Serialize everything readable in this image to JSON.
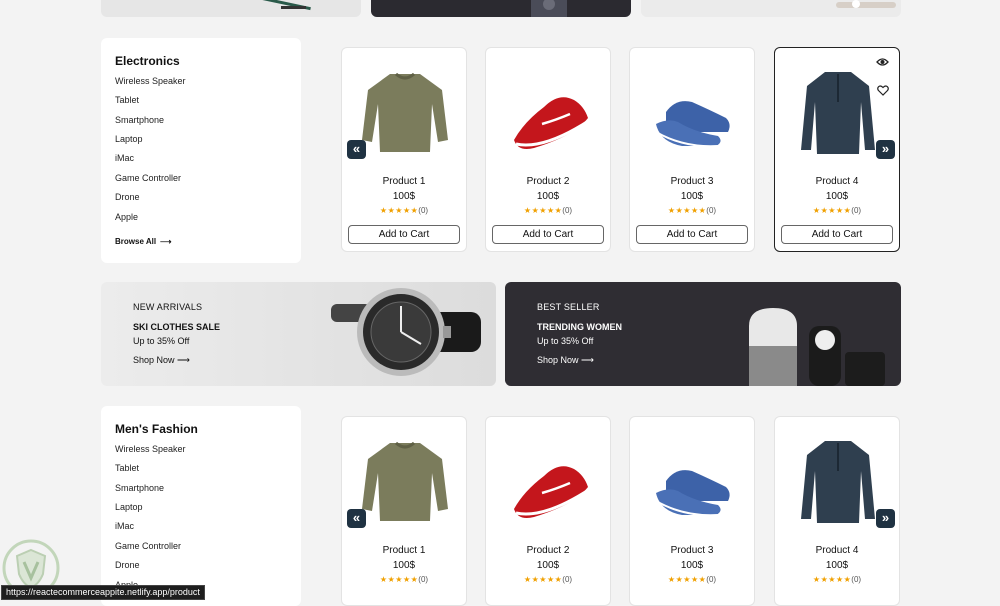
{
  "sections": [
    {
      "title": "Electronics",
      "categories": [
        "Wireless Speaker",
        "Tablet",
        "Smartphone",
        "Laptop",
        "iMac",
        "Game Controller",
        "Drone",
        "Apple"
      ],
      "browse_all": "Browse All",
      "products": [
        {
          "name": "Product 1",
          "price": "100$",
          "stars": "★★★★★",
          "count": "(0)",
          "button": "Add to Cart"
        },
        {
          "name": "Product 2",
          "price": "100$",
          "stars": "★★★★★",
          "count": "(0)",
          "button": "Add to Cart"
        },
        {
          "name": "Product 3",
          "price": "100$",
          "stars": "★★★★★",
          "count": "(0)",
          "button": "Add to Cart"
        },
        {
          "name": "Product 4",
          "price": "100$",
          "stars": "★★★★★",
          "count": "(0)",
          "button": "Add to Cart"
        }
      ]
    },
    {
      "title": "Men's Fashion",
      "categories": [
        "Wireless Speaker",
        "Tablet",
        "Smartphone",
        "Laptop",
        "iMac",
        "Game Controller",
        "Drone",
        "Apple"
      ],
      "products": [
        {
          "name": "Product 1",
          "price": "100$",
          "stars": "★★★★★",
          "count": "(0)"
        },
        {
          "name": "Product 2",
          "price": "100$",
          "stars": "★★★★★",
          "count": "(0)"
        },
        {
          "name": "Product 3",
          "price": "100$",
          "stars": "★★★★★",
          "count": "(0)"
        },
        {
          "name": "Product 4",
          "price": "100$",
          "stars": "★★★★★",
          "count": "(0)"
        }
      ]
    }
  ],
  "promos": [
    {
      "tag": "NEW ARRIVALS",
      "heading": "SKI CLOTHES SALE",
      "sub": "Up to 35% Off",
      "cta": "Shop Now"
    },
    {
      "tag": "BEST SELLER",
      "heading": "TRENDING WOMEN",
      "sub": "Up to 35% Off",
      "cta": "Shop Now"
    }
  ],
  "nav": {
    "prev": "«",
    "next": "»"
  },
  "icons": {
    "eye": "eye-icon",
    "heart": "heart-icon",
    "arrow": "arrow-right-icon"
  },
  "status_url": "https://reactecommerceappite.netlify.app/product",
  "colors": {
    "accent": "#1f3242",
    "star": "#f0a000",
    "dark_banner": "#2f2d33"
  }
}
